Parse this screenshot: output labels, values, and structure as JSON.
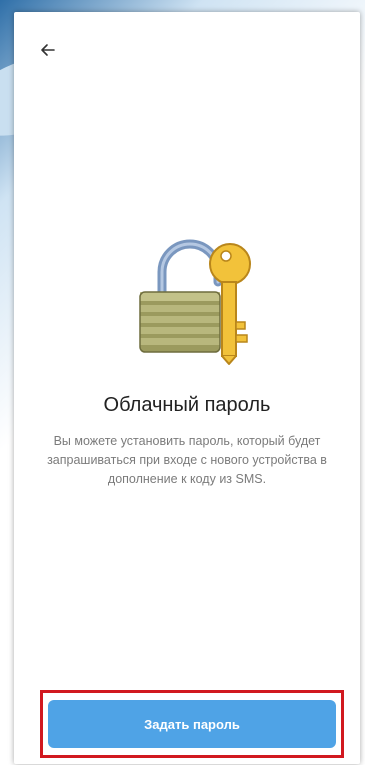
{
  "header": {
    "back_icon": "arrow-left-icon"
  },
  "main": {
    "illustration_icon": "padlock-key-icon",
    "title": "Облачный пароль",
    "description": "Вы можете установить пароль, который будет запрашиваться при входе с нового устройства в дополнение к коду из SMS."
  },
  "footer": {
    "set_password_label": "Задать пароль"
  },
  "colors": {
    "accent": "#4fa3e6",
    "highlight_border": "#d1181f",
    "description_text": "#7b7b7b"
  }
}
